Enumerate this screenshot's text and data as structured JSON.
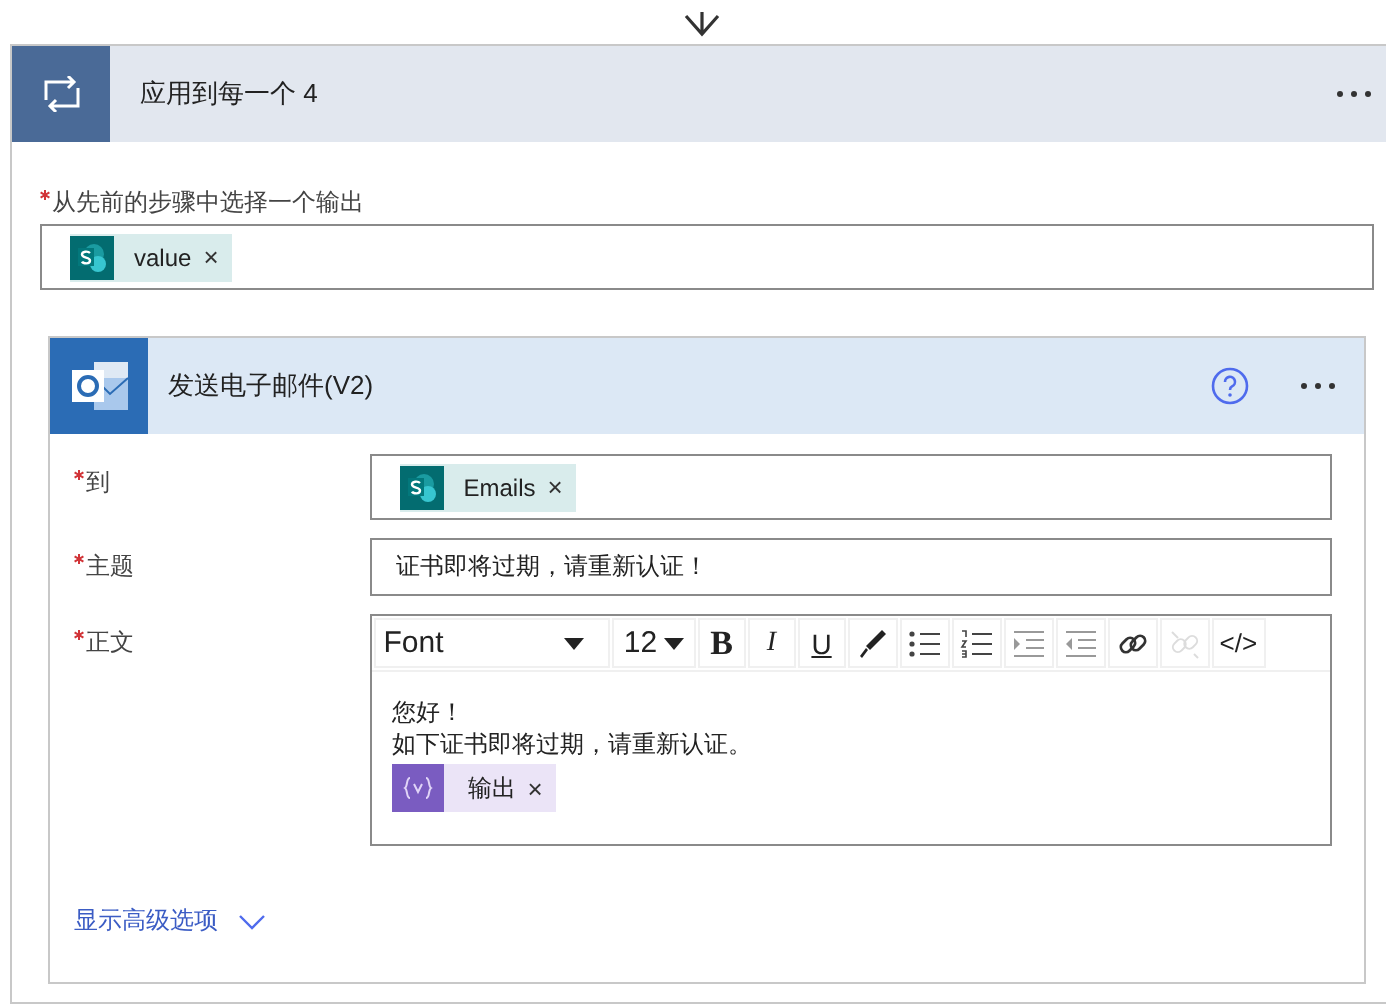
{
  "loop": {
    "title": "应用到每一个 4"
  },
  "select_output": {
    "label": "从先前的步骤中选择一个输出",
    "required": true,
    "tokens": [
      {
        "text": "value",
        "kind": "sharepoint",
        "remove": "×"
      }
    ]
  },
  "action": {
    "title": "发送电子邮件(V2)",
    "fields": [
      {
        "label": "到",
        "required": true,
        "kind": "tokens",
        "tokens": [
          {
            "text": "Emails",
            "kind": "sharepoint",
            "remove": "×"
          }
        ]
      },
      {
        "label": "主题",
        "required": true,
        "kind": "text",
        "value": "证书即将过期，请重新认证！"
      },
      {
        "label": "正文",
        "required": true,
        "kind": "editor",
        "toolbar": {
          "font": "Font",
          "size": "12",
          "buttons": [
            {
              "kind": "bold",
              "text": "B",
              "disabled": false
            },
            {
              "kind": "italic",
              "text": "I",
              "disabled": false
            },
            {
              "kind": "underline",
              "text": "U",
              "disabled": false
            },
            {
              "kind": "brush",
              "disabled": false
            },
            {
              "kind": "bullets",
              "disabled": false
            },
            {
              "kind": "numbers",
              "disabled": false
            },
            {
              "kind": "indent",
              "disabled": false
            },
            {
              "kind": "outdent",
              "disabled": false
            },
            {
              "kind": "link",
              "disabled": false
            },
            {
              "kind": "unlink",
              "disabled": true
            },
            {
              "kind": "code",
              "text": "</>",
              "disabled": false
            }
          ]
        },
        "lines": [
          "您好！",
          "如下证书即将过期，请重新认证。"
        ],
        "tokens": [
          {
            "text": "输出",
            "kind": "variable",
            "remove": "×"
          }
        ]
      }
    ],
    "advanced": "显示高级选项"
  }
}
